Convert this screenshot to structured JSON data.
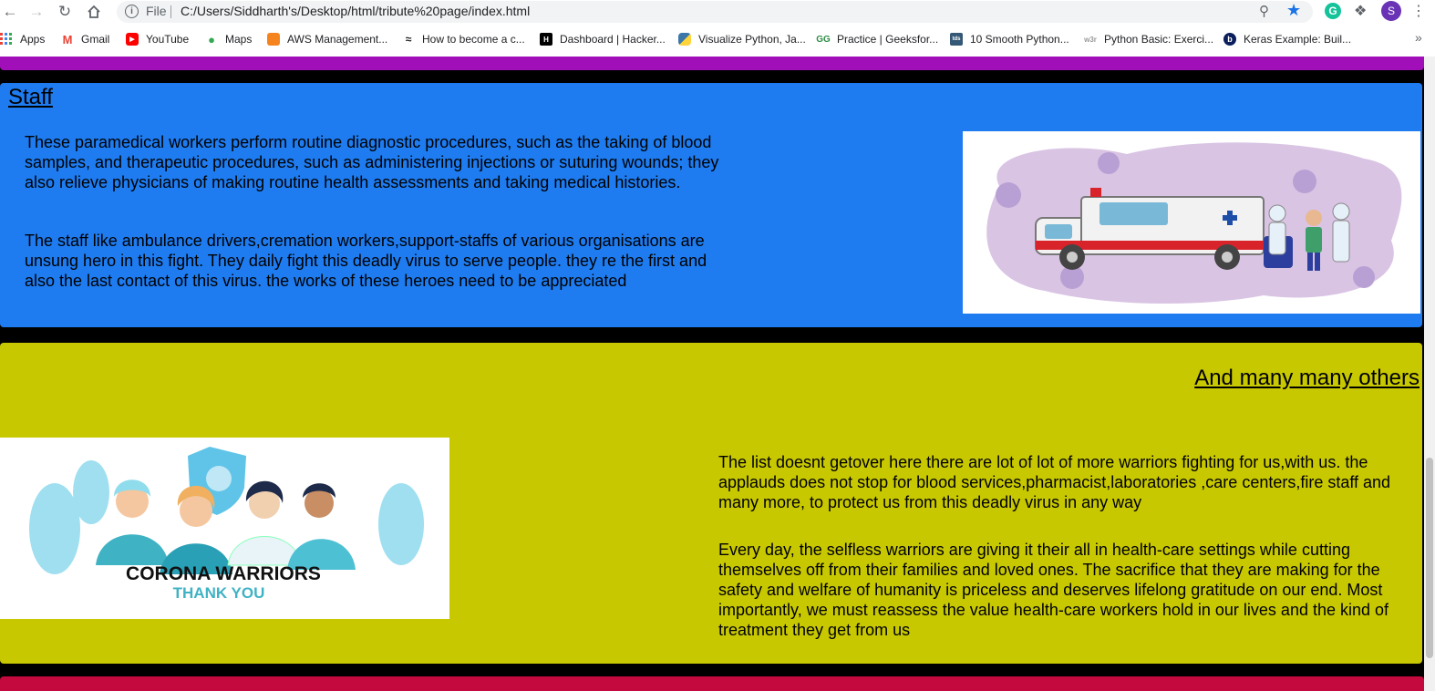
{
  "browser": {
    "scheme_label": "File",
    "url": "C:/Users/Siddharth's/Desktop/html/tribute%20page/index.html",
    "profile_initial": "S",
    "bookmarks": [
      {
        "label": "Apps",
        "icon": "apps-grid-icon"
      },
      {
        "label": "Gmail",
        "icon": "gmail-icon"
      },
      {
        "label": "YouTube",
        "icon": "youtube-icon"
      },
      {
        "label": "Maps",
        "icon": "maps-pin-icon"
      },
      {
        "label": "AWS Management...",
        "icon": "aws-icon"
      },
      {
        "label": "How to become a c...",
        "icon": "wave-icon"
      },
      {
        "label": "Dashboard | Hacker...",
        "icon": "hackerrank-icon"
      },
      {
        "label": "Visualize Python, Ja...",
        "icon": "python-icon"
      },
      {
        "label": "Practice | Geeksfor...",
        "icon": "gfg-icon"
      },
      {
        "label": "10 Smooth Python...",
        "icon": "tds-icon"
      },
      {
        "label": "Python Basic: Exerci...",
        "icon": "w3r-icon"
      },
      {
        "label": "Keras Example: Buil...",
        "icon": "b-icon"
      }
    ]
  },
  "staff": {
    "title": "Staff",
    "p1": "These paramedical workers perform routine diagnostic procedures, such as the taking of blood samples, and therapeutic procedures, such as administering injections or suturing wounds; they also relieve physicians of making routine health assessments and taking medical histories.",
    "p2": "The staff like ambulance drivers,cremation workers,support-staffs of various organisations are unsung hero in this fight. They daily fight this deadly virus to serve people. they re the first and also the last contact of this virus. the works of these heroes need to be appreciated"
  },
  "others": {
    "title": "And many many others",
    "p1": "The list doesnt getover here there are lot of lot of more warriors fighting for us,with us. the applauds does not stop for blood services,pharmacist,laboratories ,care centers,fire staff and many more, to protect us from this deadly virus in any way",
    "p2": "Every day, the selfless warriors are giving it their all in health-care settings while cutting themselves off from their families and loved ones. The sacrifice that they are making for the safety and welfare of humanity is priceless and deserves lifelong gratitude on our end. Most importantly, we must reassess the value health-care workers hold in our lives and the kind of treatment they get from us",
    "image_caption_1": "CORONA WARRIORS",
    "image_caption_2": "THANK YOU"
  },
  "colors": {
    "staff_bg": "#1e7cf0",
    "others_bg": "#c8c800",
    "purple_band": "#a00fb8",
    "crimson_band": "#c4093f"
  }
}
